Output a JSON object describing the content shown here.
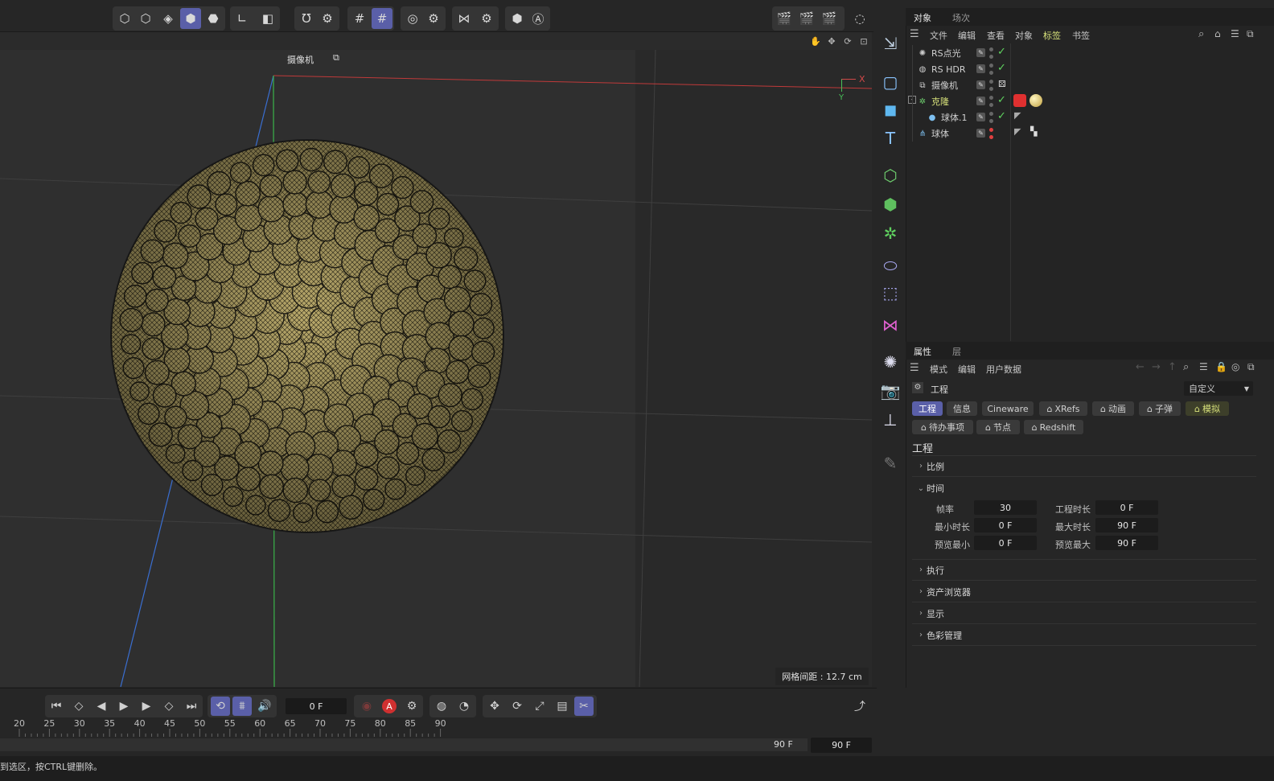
{
  "viewport": {
    "camera_label": "摄像机",
    "grid_spacing": "网格间距 : 12.7 cm",
    "axis_x": "X",
    "axis_y": "Y"
  },
  "objects_panel": {
    "tabs": [
      "对象",
      "场次"
    ],
    "menu": [
      "文件",
      "编辑",
      "查看",
      "对象",
      "标签",
      "书签"
    ],
    "active_menu": "标签",
    "rows": [
      {
        "name": "RS点光",
        "icon": "light-icon",
        "check": "green"
      },
      {
        "name": "RS HDR",
        "icon": "globe-icon",
        "check": "green"
      },
      {
        "name": "摄像机",
        "icon": "camera-object-icon",
        "check": "none"
      },
      {
        "name": "克隆",
        "icon": "cloner-icon",
        "check": "green"
      },
      {
        "name": "球体.1",
        "icon": "sphere-icon",
        "check": "green"
      },
      {
        "name": "球体",
        "icon": "matrix-icon",
        "check": "red"
      }
    ]
  },
  "attributes_panel": {
    "tabs": [
      "属性",
      "层"
    ],
    "menu": [
      "模式",
      "编辑",
      "用户数据"
    ],
    "header_title": "工程",
    "preset": "自定义",
    "tabs_row1": [
      "工程",
      "信息",
      "Cineware",
      "XRefs",
      "动画",
      "子弹",
      "模拟"
    ],
    "tabs_row2": [
      "待办事项",
      "节点",
      "Redshift"
    ],
    "section_title": "工程",
    "sections": [
      "比例",
      "时间",
      "执行",
      "资产浏览器",
      "显示",
      "色彩管理"
    ],
    "fields": {
      "fps_label": "帧率",
      "fps": "30",
      "proj_len_label": "工程时长",
      "proj_len": "0 F",
      "min_label": "最小时长",
      "min": "0 F",
      "max_label": "最大时长",
      "max": "90 F",
      "pmin_label": "预览最小",
      "pmin": "0 F",
      "pmax_label": "预览最大",
      "pmax": "90 F"
    }
  },
  "timeline": {
    "current_frame": "0 F",
    "end_frame_a": "90 F",
    "end_frame_b": "90 F",
    "ticks": [
      "20",
      "25",
      "30",
      "35",
      "40",
      "45",
      "50",
      "55",
      "60",
      "65",
      "70",
      "75",
      "80",
      "85",
      "90"
    ]
  },
  "status_bar": {
    "text": "到选区，按CTRL键删除。"
  },
  "colors": {
    "accent": "#5a5fa8",
    "highlight": "#d6e07a",
    "check": "#5fd35f",
    "sphere": "#b8a86a"
  }
}
